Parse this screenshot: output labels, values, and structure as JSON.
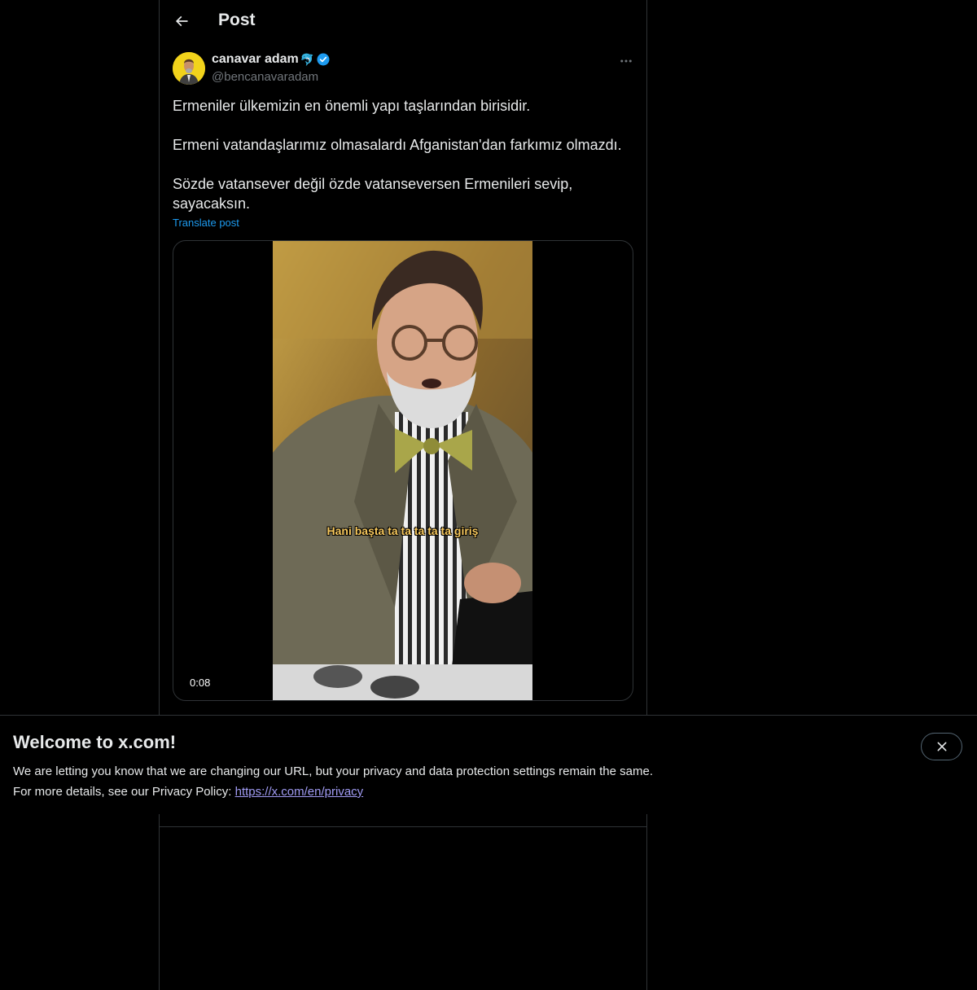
{
  "header": {
    "title": "Post",
    "back_icon": "arrow-left-icon"
  },
  "post": {
    "author": {
      "name": "canavar adam",
      "emoji": "🐬",
      "handle": "@bencanavaradam",
      "verified": true,
      "verified_color": "#1d9bf0"
    },
    "paragraphs": [
      "Ermeniler ülkemizin en önemli yapı taşlarından birisidir.",
      "Ermeni vatandaşlarımız olmasalardı Afganistan'dan farkımız olmazdı.",
      "Sözde vatansever değil özde vatanseversen Ermenileri sevip, sayacaksın."
    ],
    "translate_label": "Translate post",
    "video": {
      "subtitle": "Hani başta ta ta ta ta ta giriş",
      "timestamp": "0:08"
    }
  },
  "banner": {
    "title": "Welcome to x.com!",
    "line1": "We are letting you know that we are changing our URL, but your privacy and data protection settings remain the same.",
    "line2_prefix": "For more details, see our Privacy Policy:",
    "link_text": "https://x.com/en/privacy",
    "close_icon": "close-icon"
  },
  "colors": {
    "accent": "#1d9bf0",
    "link": "#a09bf3",
    "border": "#2f3336",
    "muted": "#71767b"
  }
}
